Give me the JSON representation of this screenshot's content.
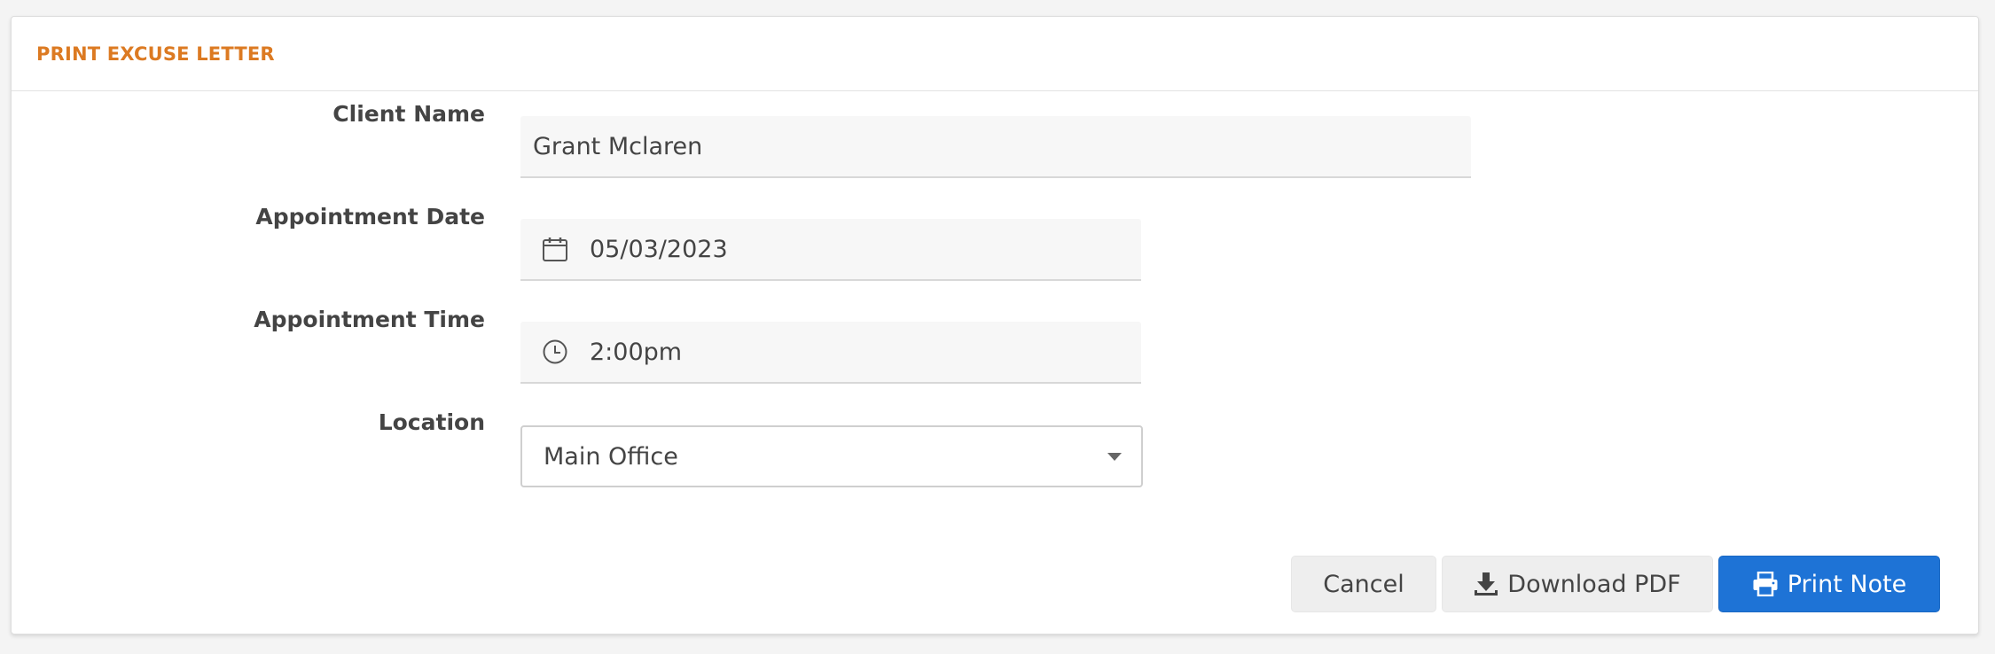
{
  "header": {
    "title": "PRINT EXCUSE LETTER"
  },
  "form": {
    "client_name": {
      "label": "Client Name",
      "value": "Grant Mclaren"
    },
    "appointment_date": {
      "label": "Appointment Date",
      "value": "05/03/2023",
      "icon": "calendar-icon"
    },
    "appointment_time": {
      "label": "Appointment Time",
      "value": "2:00pm",
      "icon": "clock-icon"
    },
    "location": {
      "label": "Location",
      "value": "Main Office",
      "icon": "chevron-down-icon"
    }
  },
  "actions": {
    "cancel_label": "Cancel",
    "download_label": "Download PDF",
    "download_icon": "download-icon",
    "print_label": "Print Note",
    "print_icon": "printer-icon"
  },
  "colors": {
    "title": "#dc7a22",
    "primary": "#1e73d6"
  }
}
